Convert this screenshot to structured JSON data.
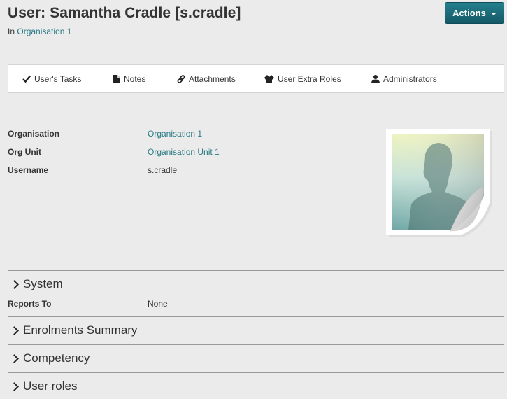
{
  "header": {
    "title": "User: Samantha Cradle [s.cradle]",
    "in_prefix": "In",
    "organisation_link": "Organisation 1",
    "actions_label": "Actions"
  },
  "tabs": [
    {
      "label": "User's Tasks",
      "icon": "check-icon"
    },
    {
      "label": "Notes",
      "icon": "document-icon"
    },
    {
      "label": "Attachments",
      "icon": "link-icon"
    },
    {
      "label": "User Extra Roles",
      "icon": "jacket-icon"
    },
    {
      "label": "Administrators",
      "icon": "person-icon"
    }
  ],
  "details": [
    {
      "label": "Organisation",
      "value": "Organisation 1",
      "is_link": true
    },
    {
      "label": "Org Unit",
      "value": "Organisation Unit 1",
      "is_link": true
    },
    {
      "label": "Username",
      "value": "s.cradle",
      "is_link": false
    }
  ],
  "photo": {
    "icon": "user-placeholder-photo"
  },
  "sections": [
    {
      "title": "System",
      "expanded": true,
      "rows": [
        {
          "label": "Reports To",
          "value": "None"
        }
      ]
    },
    {
      "title": "Enrolments Summary",
      "expanded": false
    },
    {
      "title": "Competency",
      "expanded": false
    },
    {
      "title": "User roles",
      "expanded": false
    }
  ],
  "colors": {
    "link": "#2a7a85",
    "accent": "#1d6d7a",
    "background": "#ebebeb"
  }
}
